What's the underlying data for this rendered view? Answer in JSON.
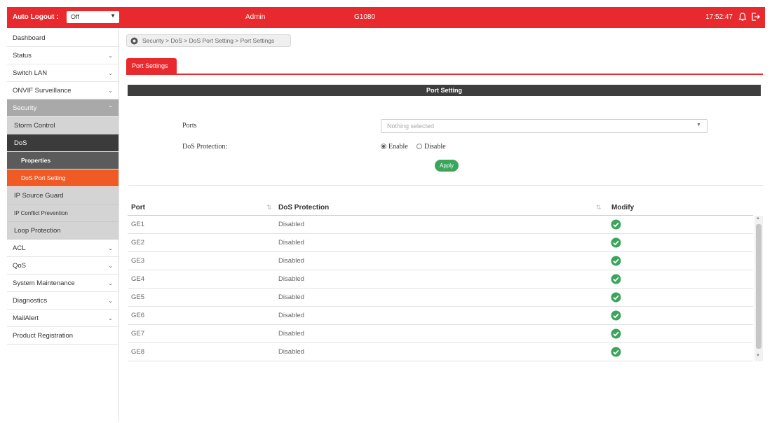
{
  "topbar": {
    "auto_logout_label": "Auto Logout :",
    "auto_logout_value": "Off",
    "user": "Admin",
    "model": "G1080",
    "time": "17:52:47",
    "accent_color": "#e8292e"
  },
  "sidebar": {
    "items": [
      {
        "label": "Dashboard"
      },
      {
        "label": "Status"
      },
      {
        "label": "Switch LAN"
      },
      {
        "label": "ONVIF Surveillance"
      },
      {
        "label": "Security"
      },
      {
        "label": "Storm Control"
      },
      {
        "label": "DoS"
      },
      {
        "label": "Properties"
      },
      {
        "label": "DoS Port Setting"
      },
      {
        "label": "IP Source Guard"
      },
      {
        "label": "IP Conflict Prevention"
      },
      {
        "label": "Loop Protection"
      },
      {
        "label": "ACL"
      },
      {
        "label": "QoS"
      },
      {
        "label": "System Maintenance"
      },
      {
        "label": "Diagnostics"
      },
      {
        "label": "MailAlert"
      },
      {
        "label": "Product Registration"
      }
    ]
  },
  "breadcrumb": "Security > DoS > DoS Port Setting > Port Settings",
  "tab": {
    "label": "Port Settings"
  },
  "section": {
    "title": "Port Setting"
  },
  "form": {
    "ports_label": "Ports",
    "ports_placeholder": "Nothing selected",
    "dos_label": "DoS Protection:",
    "enable_label": "Enable",
    "disable_label": "Disable",
    "selected": "Enable",
    "apply_label": "Apply"
  },
  "table": {
    "headers": {
      "port": "Port",
      "dos": "DoS Protection",
      "modify": "Modify"
    },
    "rows": [
      {
        "port": "GE1",
        "status": "Disabled"
      },
      {
        "port": "GE2",
        "status": "Disabled"
      },
      {
        "port": "GE3",
        "status": "Disabled"
      },
      {
        "port": "GE4",
        "status": "Disabled"
      },
      {
        "port": "GE5",
        "status": "Disabled"
      },
      {
        "port": "GE6",
        "status": "Disabled"
      },
      {
        "port": "GE7",
        "status": "Disabled"
      },
      {
        "port": "GE8",
        "status": "Disabled"
      }
    ],
    "modify_icon": "check-circle-icon",
    "modify_color": "#3aa55b"
  }
}
